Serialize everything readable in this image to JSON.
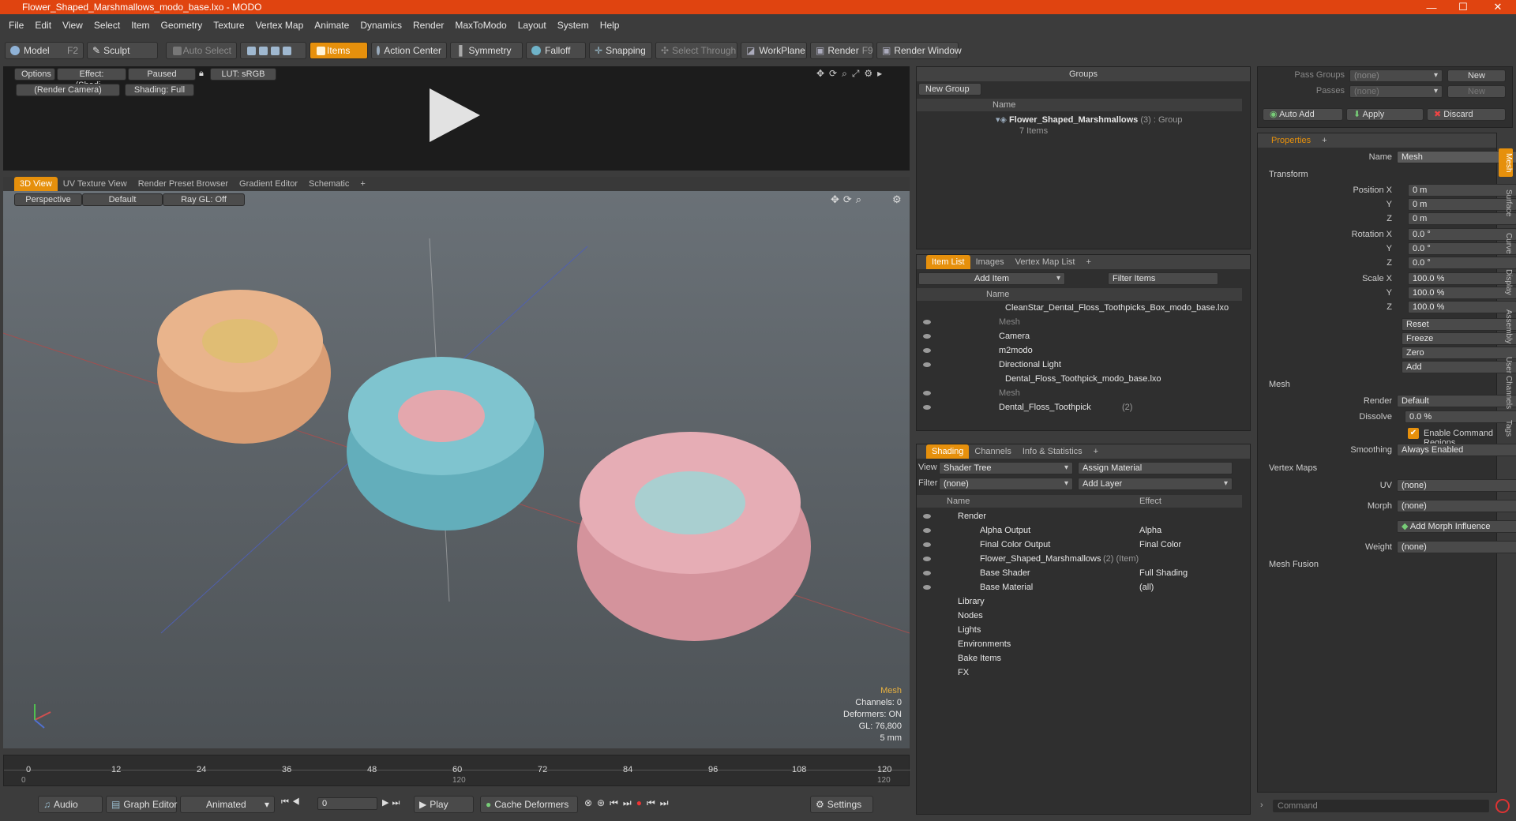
{
  "window": {
    "title": "Flower_Shaped_Marshmallows_modo_base.lxo - MODO",
    "min": "—",
    "max": "☐",
    "close": "✕"
  },
  "menu": [
    "File",
    "Edit",
    "View",
    "Select",
    "Item",
    "Geometry",
    "Texture",
    "Vertex Map",
    "Animate",
    "Dynamics",
    "Render",
    "MaxToModo",
    "Layout",
    "System",
    "Help"
  ],
  "toolbar": {
    "model": "Model",
    "model_key": "F2",
    "sculpt": "Sculpt",
    "auto_select": "Auto Select",
    "items": "Items",
    "action_center": "Action Center",
    "symmetry": "Symmetry",
    "falloff": "Falloff",
    "snapping": "Snapping",
    "select_through": "Select Through",
    "workplane": "WorkPlane",
    "render": "Render",
    "render_key": "F9",
    "render_window": "Render Window"
  },
  "preview": {
    "options": "Options",
    "effect": "Effect: (Shadi...",
    "paused": "Paused",
    "lut": "LUT: sRGB",
    "camera": "(Render Camera)",
    "shading": "Shading: Full"
  },
  "viewport_tabs": [
    "3D View",
    "UV Texture View",
    "Render Preset Browser",
    "Gradient Editor",
    "Schematic",
    "+"
  ],
  "viewport": {
    "perspective": "Perspective",
    "default": "Default",
    "raygl": "Ray GL: Off",
    "info_title": "Mesh",
    "channels": "Channels: 0",
    "deformers": "Deformers: ON",
    "gl": "GL: 76,800",
    "scale": "5 mm"
  },
  "timeline": {
    "ticks": [
      "0",
      "12",
      "24",
      "36",
      "48",
      "60",
      "72",
      "84",
      "96",
      "108",
      "120"
    ],
    "range_start": "0",
    "range_mid": "120",
    "range_end": "120"
  },
  "transport": {
    "audio": "Audio",
    "graph_editor": "Graph Editor",
    "animated": "Animated",
    "frame": "0",
    "play": "Play",
    "cache": "Cache Deformers",
    "settings": "Settings"
  },
  "groups": {
    "title": "Groups",
    "new_group": "New Group",
    "col_name": "Name",
    "item_name": "Flower_Shaped_Marshmallows",
    "item_count": "(3)",
    "item_type": ": Group",
    "item_sub": "7 Items"
  },
  "itemlist": {
    "tabs": [
      "Item List",
      "Images",
      "Vertex Map List",
      "+"
    ],
    "add_item": "Add Item",
    "filter": "Filter Items",
    "col_name": "Name",
    "rows": [
      {
        "label": "CleanStar_Dental_Floss_Toothpicks_Box_modo_base.lxo",
        "indent": 0,
        "dim": false
      },
      {
        "label": "Mesh",
        "indent": 2,
        "dim": true
      },
      {
        "label": "Camera",
        "indent": 2,
        "dim": false
      },
      {
        "label": "m2modo",
        "indent": 2,
        "dim": false
      },
      {
        "label": "Directional Light",
        "indent": 2,
        "dim": false
      },
      {
        "label": "Dental_Floss_Toothpick_modo_base.lxo",
        "indent": 0,
        "dim": false
      },
      {
        "label": "Mesh",
        "indent": 2,
        "dim": true
      },
      {
        "label": "Dental_Floss_Toothpick",
        "indent": 2,
        "dim": false,
        "count": "(2)"
      }
    ]
  },
  "shading": {
    "tabs": [
      "Shading",
      "Channels",
      "Info & Statistics",
      "+"
    ],
    "view_label": "View",
    "view_value": "Shader Tree",
    "assign": "Assign Material",
    "filter_label": "Filter",
    "filter_value": "(none)",
    "add_layer": "Add Layer",
    "col_name": "Name",
    "col_effect": "Effect",
    "rows": [
      {
        "label": "Render",
        "effect": "",
        "indent": 0
      },
      {
        "label": "Alpha Output",
        "effect": "Alpha",
        "indent": 1
      },
      {
        "label": "Final Color Output",
        "effect": "Final Color",
        "indent": 1
      },
      {
        "label": "Flower_Shaped_Marshmallows",
        "extra": "(2) (Item)",
        "effect": "",
        "indent": 1
      },
      {
        "label": "Base Shader",
        "effect": "Full Shading",
        "indent": 1
      },
      {
        "label": "Base Material",
        "effect": "(all)",
        "indent": 1
      },
      {
        "label": "Library",
        "effect": "",
        "indent": 0
      },
      {
        "label": "Nodes",
        "effect": "",
        "indent": 0
      },
      {
        "label": "Lights",
        "effect": "",
        "indent": 0
      },
      {
        "label": "Environments",
        "effect": "",
        "indent": 0
      },
      {
        "label": "Bake Items",
        "effect": "",
        "indent": 0
      },
      {
        "label": "FX",
        "effect": "",
        "indent": 0
      }
    ]
  },
  "passes": {
    "pass_groups": "Pass Groups",
    "passes": "Passes",
    "none": "(none)",
    "new": "New",
    "auto_add": "Auto Add",
    "apply": "Apply",
    "discard": "Discard"
  },
  "properties": {
    "tab": "Properties",
    "name_label": "Name",
    "name_value": "Mesh",
    "transform": "Transform",
    "pos_label": "Position X",
    "y": "Y",
    "z": "Z",
    "pos": [
      "0 m",
      "0 m",
      "0 m"
    ],
    "rot_label": "Rotation X",
    "rot": [
      "0.0 °",
      "0.0 °",
      "0.0 °"
    ],
    "scale_label": "Scale X",
    "scale": [
      "100.0 %",
      "100.0 %",
      "100.0 %"
    ],
    "reset": "Reset",
    "freeze": "Freeze",
    "zero": "Zero",
    "add": "Add",
    "mesh": "Mesh",
    "render_label": "Render",
    "render_value": "Default",
    "dissolve_label": "Dissolve",
    "dissolve_value": "0.0 %",
    "enable_cmd": "Enable Command Regions",
    "smoothing_label": "Smoothing",
    "smoothing_value": "Always Enabled",
    "vertex_maps": "Vertex Maps",
    "uv_label": "UV",
    "uv_value": "(none)",
    "morph_label": "Morph",
    "morph_value": "(none)",
    "add_morph": "Add Morph Influence",
    "weight_label": "Weight",
    "weight_value": "(none)",
    "mesh_fusion": "Mesh Fusion",
    "command": "Command"
  },
  "side_tabs": [
    "Mesh",
    "Surface",
    "Curve",
    "Display",
    "Assembly",
    "User Channels",
    "Tags"
  ],
  "colors": {
    "title": "#e04410",
    "accent": "#e6900c",
    "peach": "#e9b48c",
    "cyan": "#7fc4cf",
    "pink": "#e6adb5"
  }
}
